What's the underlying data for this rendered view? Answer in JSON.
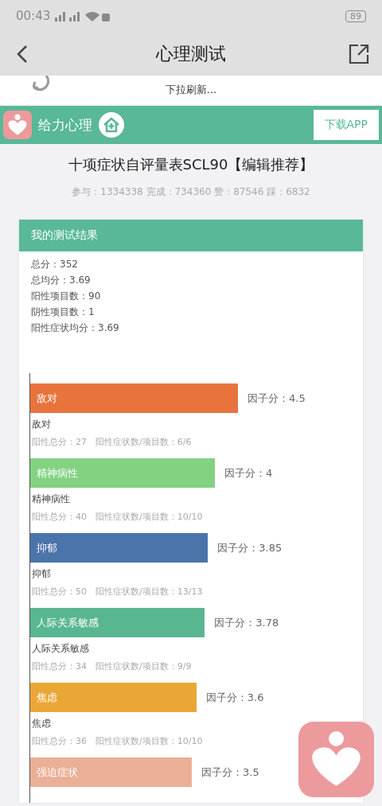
{
  "status_bar": {
    "time": "00:43",
    "battery": "89"
  },
  "nav": {
    "title": "心理测试"
  },
  "refresh": {
    "text": "下拉刷新..."
  },
  "banner": {
    "brand": "给力心理",
    "download": "下载APP"
  },
  "test": {
    "title": "十项症状自评量表SCL90【编辑推荐】",
    "stats": "参与：1334338 完成：734360 赞：87546 踩：6832"
  },
  "result": {
    "header": "我的测试结果",
    "summary": [
      "总分：352",
      "总均分：3.69",
      "阳性项目数：90",
      "阴性项目数：1",
      "阳性症状均分：3.69"
    ],
    "factors": [
      {
        "name": "敌对",
        "color": "#e8733d",
        "score": "因子分：4.5",
        "subtitle": "敌对",
        "detail": "阳性总分：27　阳性症状数/项目数：6/6"
      },
      {
        "name": "精神病性",
        "color": "#82d282",
        "score": "因子分：4",
        "subtitle": "精神病性",
        "detail": "阳性总分：40　阳性症状数/项目数：10/10"
      },
      {
        "name": "抑郁",
        "color": "#4a74aa",
        "score": "因子分：3.85",
        "subtitle": "抑郁",
        "detail": "阳性总分：50　阳性症状数/项目数：13/13"
      },
      {
        "name": "人际关系敏感",
        "color": "#58b690",
        "score": "因子分：3.78",
        "subtitle": "人际关系敏感",
        "detail": "阳性总分：34　阳性症状数/项目数：9/9"
      },
      {
        "name": "焦虑",
        "color": "#eba736",
        "score": "因子分：3.6",
        "subtitle": "焦虑",
        "detail": "阳性总分：36　阳性症状数/项目数：10/10"
      },
      {
        "name": "强迫症状",
        "color": "#eaaf96",
        "score": "因子分：3.5"
      }
    ]
  }
}
